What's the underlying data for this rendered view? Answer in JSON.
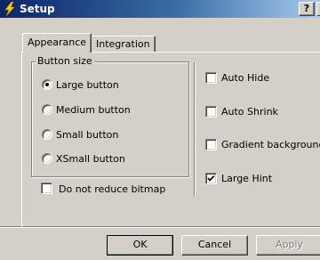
{
  "window": {
    "title": "Setup",
    "help_label": "?",
    "icon": "lightning-bolt-icon"
  },
  "tabs": [
    {
      "label": "Appearance",
      "active": true
    },
    {
      "label": "Integration",
      "active": false
    }
  ],
  "button_size": {
    "legend": "Button size",
    "options": [
      {
        "label": "Large button",
        "selected": true
      },
      {
        "label": "Medium button",
        "selected": false
      },
      {
        "label": "Small button",
        "selected": false
      },
      {
        "label": "XSmall button",
        "selected": false
      }
    ]
  },
  "checkboxes": {
    "reduce_bitmap": {
      "label": "Do not reduce bitmap",
      "checked": false
    },
    "auto_hide": {
      "label": "Auto Hide",
      "checked": false
    },
    "auto_shrink": {
      "label": "Auto Shrink",
      "checked": false
    },
    "gradient_background": {
      "label": "Gradient background",
      "checked": false
    },
    "large_hint": {
      "label": "Large Hint",
      "checked": true
    }
  },
  "buttons": {
    "ok": "OK",
    "cancel": "Cancel",
    "apply": "Apply"
  },
  "colors": {
    "title_start": "#0a246a",
    "title_end": "#a6caf0",
    "face": "#d4d0c8"
  }
}
